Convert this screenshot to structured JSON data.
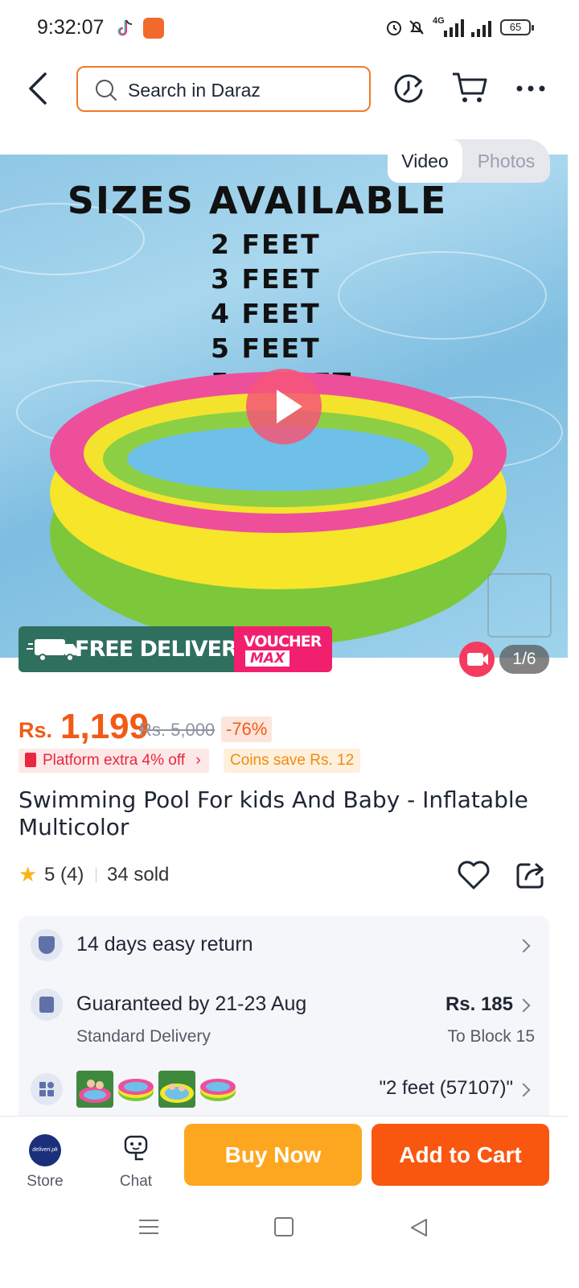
{
  "status_bar": {
    "time": "9:32:07",
    "network": "4G",
    "battery": "65"
  },
  "top_nav": {
    "search_placeholder": "Search in Daraz"
  },
  "media": {
    "image_headline": "SIZES AVAILABLE",
    "image_sizes": [
      "2 FEET",
      "3 FEET",
      "4 FEET",
      "5 FEET",
      "5.5 FEET"
    ],
    "tabs": [
      "Video",
      "Photos"
    ],
    "active_tab": "Video",
    "promo_free_delivery": "FREE DELIVERY",
    "promo_voucher": "VOUCHER",
    "promo_max": "MAX",
    "counter": "1/6"
  },
  "price": {
    "currency": "Rs.",
    "current": "1,199",
    "original": "Rs. 5,000",
    "discount": "-76%"
  },
  "offers": {
    "platform": "Platform extra 4% off",
    "coins": "Coins save Rs. 12"
  },
  "product": {
    "title": "Swimming Pool For kids And Baby -  Inflatable Multicolor",
    "rating": "5 (4)",
    "sold": "34 sold"
  },
  "info": {
    "return_policy": "14 days easy return",
    "guarantee": "Guaranteed by 21-23 Aug",
    "delivery_type": "Standard Delivery",
    "delivery_fee": "Rs. 185",
    "delivery_destination": "To Block 15",
    "selected_variant": "\"2 feet (57107)\""
  },
  "bottom_bar": {
    "store_label": "Store",
    "store_logo_text": "deliveri.pk",
    "chat_label": "Chat",
    "buy_now": "Buy Now",
    "add_to_cart": "Add to Cart"
  },
  "colors": {
    "accent_orange": "#f9560f",
    "buy_now_yellow": "#fda720",
    "price_orange": "#f25a14"
  }
}
